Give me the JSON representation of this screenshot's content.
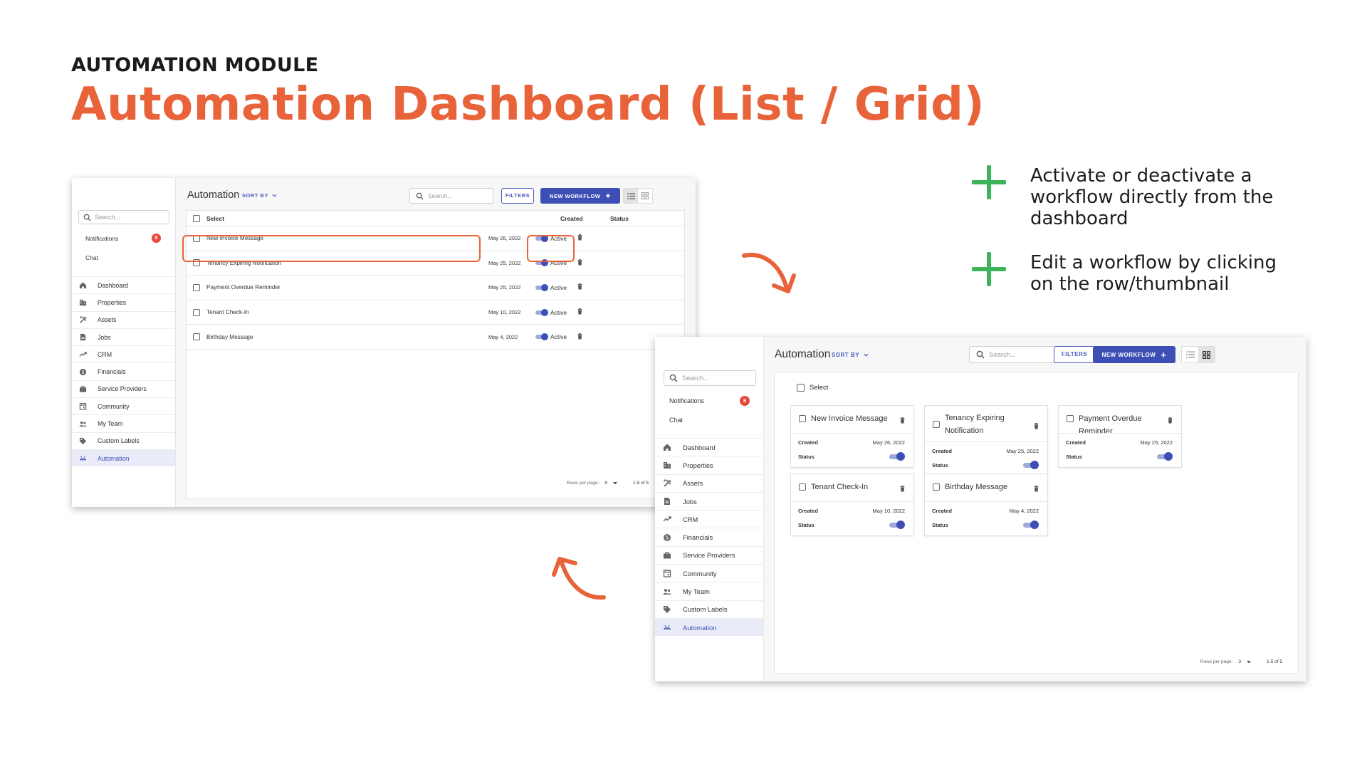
{
  "slide": {
    "eyebrow": "AUTOMATION MODULE",
    "headline": "Automation Dashboard (List / Grid)",
    "accent_color": "#e8633a",
    "plus_color": "#3db35a"
  },
  "features": [
    {
      "text": "Activate or deactivate a workflow directly from the dashboard",
      "icon": "plus-icon"
    },
    {
      "text": "Edit a workflow by clicking on the row/thumbnail",
      "icon": "plus-icon"
    }
  ],
  "sidebar": {
    "search_placeholder": "Search...",
    "notifications_label": "Notifications",
    "notifications_count": "8",
    "chat_label": "Chat",
    "items": [
      {
        "label": "Dashboard",
        "icon": "home-icon"
      },
      {
        "label": "Properties",
        "icon": "building-icon"
      },
      {
        "label": "Assets",
        "icon": "tools-icon"
      },
      {
        "label": "Jobs",
        "icon": "document-icon"
      },
      {
        "label": "CRM",
        "icon": "trend-icon"
      },
      {
        "label": "Financials",
        "icon": "dollar-icon"
      },
      {
        "label": "Service Providers",
        "icon": "briefcase-icon"
      },
      {
        "label": "Community",
        "icon": "calendar-icon"
      },
      {
        "label": "My Team",
        "icon": "people-icon"
      },
      {
        "label": "Custom Labels",
        "icon": "tag-icon"
      },
      {
        "label": "Automation",
        "icon": "robot-icon",
        "active": true
      }
    ]
  },
  "toolbar": {
    "title": "Automation",
    "sort_by": "SORT BY",
    "search_placeholder": "Search...",
    "filters": "FILTERS",
    "new_workflow": "NEW WORKFLOW",
    "new_icon": "+"
  },
  "list_view": {
    "select_label": "Select",
    "col_created": "Created",
    "col_status": "Status",
    "rows": [
      {
        "name": "New Invoice Message",
        "created": "May 26, 2022",
        "status": "Active"
      },
      {
        "name": "Tenancy Expiring Notification",
        "created": "May 25, 2022",
        "status": "Active"
      },
      {
        "name": "Payment Overdue Reminder",
        "created": "May 25, 2022",
        "status": "Active"
      },
      {
        "name": "Tenant Check-In",
        "created": "May 10, 2022",
        "status": "Active"
      },
      {
        "name": "Birthday Message",
        "created": "May 4, 2022",
        "status": "Active"
      }
    ],
    "rows_per_page_label": "Rows per page:",
    "rows_per_page_value": "9",
    "range": "1-5 of 5"
  },
  "grid_view": {
    "select_label": "Select",
    "created_label": "Created",
    "status_label": "Status",
    "cards": [
      {
        "name": "New Invoice Message",
        "created": "May 26, 2022"
      },
      {
        "name": "Tenancy Expiring Notification",
        "created": "May 25, 2022"
      },
      {
        "name": "Payment Overdue Reminder",
        "created": "May 25, 2022"
      },
      {
        "name": "Tenant Check-In",
        "created": "May 10, 2022"
      },
      {
        "name": "Birthday Message",
        "created": "May 4, 2022"
      }
    ],
    "rows_per_page_label": "Rows per page:",
    "rows_per_page_value": "3",
    "range": "1-5 of 5"
  }
}
